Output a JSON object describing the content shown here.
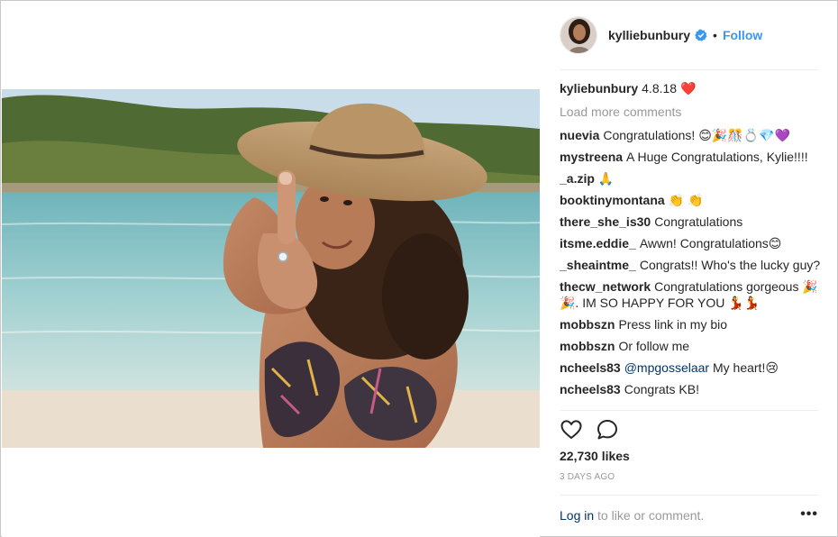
{
  "post": {
    "username": "kylliebunbury",
    "follow_label": "Follow",
    "separator": "•",
    "caption_user": "kyliebunbury",
    "caption_text": "4.8.18 ❤️",
    "load_more": "Load more comments",
    "likes": "22,730 likes",
    "time_ago": "3 DAYS AGO",
    "login_link": "Log in",
    "login_rest": " to like or comment.",
    "options": "•••"
  },
  "comments": [
    {
      "user": "nuevia",
      "text": "Congratulations! 😊🎉🎊💍💎💜"
    },
    {
      "user": "mystreena",
      "text": "A Huge Congratulations, Kylie!!!!"
    },
    {
      "user": "_a.zip",
      "text": "🙏"
    },
    {
      "user": "booktinymontana",
      "text": "👏 👏"
    },
    {
      "user": "there_she_is30",
      "text": "Congratulations"
    },
    {
      "user": "itsme.eddie_",
      "text": "Awwn! Congratulations😊"
    },
    {
      "user": "_sheaintme_",
      "text": "Congrats!! Who's the lucky guy?"
    },
    {
      "user": "thecw_network",
      "text": "Congratulations gorgeous 🎉🎉. IM SO HAPPY FOR YOU 💃💃"
    },
    {
      "user": "mobbszn",
      "text": "Press link in my bio"
    },
    {
      "user": "mobbszn",
      "text": "Or follow me"
    },
    {
      "user": "ncheels83",
      "mention": "@mpgosselaar",
      "text": " My heart!😢"
    },
    {
      "user": "ncheels83",
      "text": "Congrats KB!"
    }
  ],
  "colors": {
    "link_blue": "#3897f0",
    "verified_blue": "#3897f0",
    "dark_link": "#003569",
    "muted": "#999999"
  },
  "icons": {
    "verified": "verified-badge-icon",
    "like": "heart-icon",
    "comment": "comment-bubble-icon"
  }
}
